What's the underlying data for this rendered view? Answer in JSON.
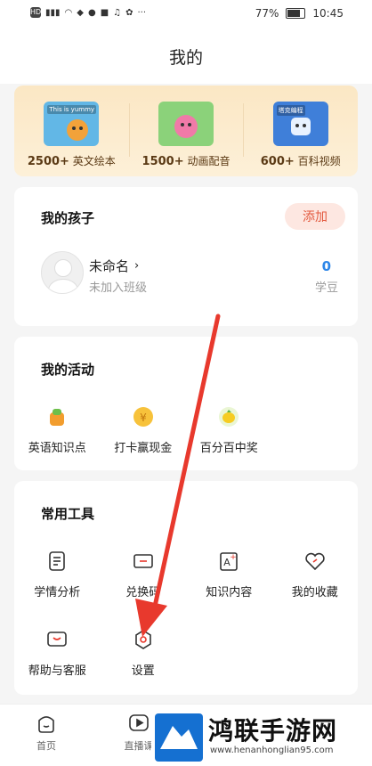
{
  "status": {
    "left_text": "HD",
    "battery": "77%",
    "time": "10:45"
  },
  "header": {
    "title": "我的"
  },
  "banner": [
    {
      "count": "2500+",
      "label": "英文绘本",
      "tag": "This is yummy",
      "color": "#62b7e6"
    },
    {
      "count": "1500+",
      "label": "动画配音",
      "tag": "",
      "color": "#8bd27a"
    },
    {
      "count": "600+",
      "label": "百科视频",
      "tag": "塔克编程",
      "color": "#3f7fd9"
    }
  ],
  "children": {
    "title": "我的孩子",
    "add_label": "添加",
    "name": "未命名",
    "class_status": "未加入班级",
    "coins_value": "0",
    "coins_label": "学豆"
  },
  "activities": {
    "title": "我的活动",
    "items": [
      {
        "label": "英语知识点",
        "icon": "green-bag-icon"
      },
      {
        "label": "打卡赢现金",
        "icon": "yuan-coin-icon"
      },
      {
        "label": "百分百中奖",
        "icon": "lemon-prize-icon"
      }
    ]
  },
  "tools": {
    "title": "常用工具",
    "items": [
      {
        "label": "学情分析",
        "icon": "report-icon"
      },
      {
        "label": "兑换码",
        "icon": "ticket-icon"
      },
      {
        "label": "知识内容",
        "icon": "knowledge-icon"
      },
      {
        "label": "我的收藏",
        "icon": "heart-icon"
      },
      {
        "label": "帮助与客服",
        "icon": "message-smile-icon"
      },
      {
        "label": "设置",
        "icon": "gear-icon"
      }
    ]
  },
  "tabbar": {
    "items": [
      {
        "label": "首页",
        "icon": "home-icon"
      },
      {
        "label": "直播课",
        "icon": "play-icon"
      }
    ]
  },
  "watermark": {
    "title": "鸿联手游网",
    "url": "www.henanhonglian95.com"
  },
  "colors": {
    "accent_red": "#e8392d",
    "coins_blue": "#2d86e8",
    "add_bg": "#fde7e1"
  }
}
